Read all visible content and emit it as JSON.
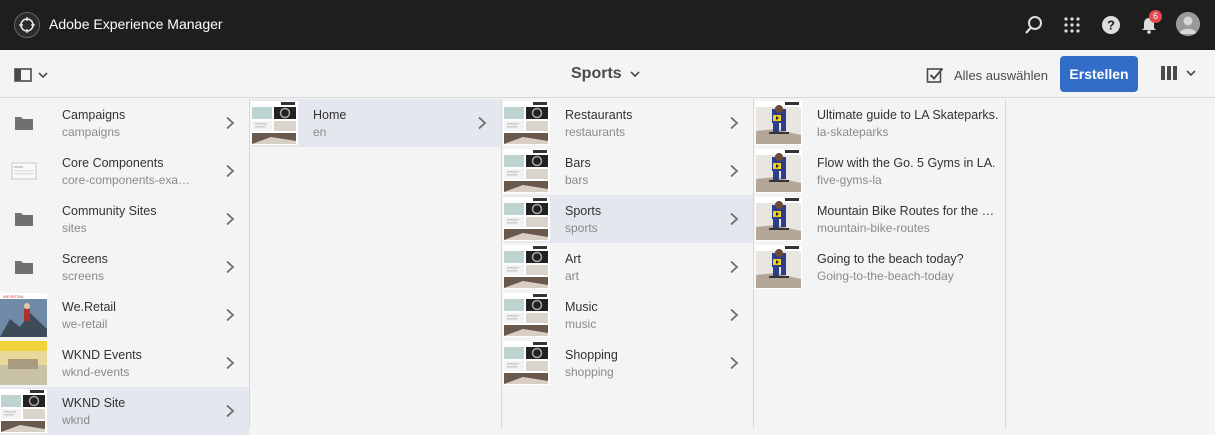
{
  "topbar": {
    "app_title": "Adobe Experience Manager",
    "notification_count": "6",
    "icons": [
      "search-icon",
      "apps-grid-icon",
      "help-icon",
      "bell-icon",
      "avatar"
    ]
  },
  "actionbar": {
    "title": "Sports",
    "select_all_label": "Alles auswählen",
    "create_label": "Erstellen"
  },
  "colors": {
    "topbar_bg": "#1e1e1e",
    "accent": "#326ec8",
    "active_row": "#e4e7ee",
    "badge": "#e34850"
  },
  "columns": [
    {
      "items": [
        {
          "title": "Campaigns",
          "name": "campaigns",
          "thumb": "folder",
          "active": false
        },
        {
          "title": "Core Components",
          "name": "core-components-exa…",
          "thumb": "template",
          "active": false
        },
        {
          "title": "Community Sites",
          "name": "sites",
          "thumb": "folder",
          "active": false
        },
        {
          "title": "Screens",
          "name": "screens",
          "thumb": "folder",
          "active": false
        },
        {
          "title": "We.Retail",
          "name": "we-retail",
          "thumb": "photo-hiker",
          "active": false
        },
        {
          "title": "WKND Events",
          "name": "wknd-events",
          "thumb": "photo-yellow",
          "active": false
        },
        {
          "title": "WKND Site",
          "name": "wknd",
          "thumb": "page",
          "active": true
        }
      ]
    },
    {
      "items": [
        {
          "title": "Home",
          "name": "en",
          "thumb": "page",
          "active": true
        }
      ]
    },
    {
      "items": [
        {
          "title": "Restaurants",
          "name": "restaurants",
          "thumb": "page",
          "active": false
        },
        {
          "title": "Bars",
          "name": "bars",
          "thumb": "page",
          "active": false
        },
        {
          "title": "Sports",
          "name": "sports",
          "thumb": "page",
          "active": true
        },
        {
          "title": "Art",
          "name": "art",
          "thumb": "page",
          "active": false
        },
        {
          "title": "Music",
          "name": "music",
          "thumb": "page",
          "active": false
        },
        {
          "title": "Shopping",
          "name": "shopping",
          "thumb": "page",
          "active": false
        }
      ]
    },
    {
      "items": [
        {
          "title": "Ultimate guide to LA Skateparks.",
          "name": "la-skateparks",
          "thumb": "skater",
          "active": false
        },
        {
          "title": "Flow with the Go. 5 Gyms in LA.",
          "name": "five-gyms-la",
          "thumb": "skater",
          "active": false
        },
        {
          "title": "Mountain Bike Routes for the …",
          "name": "mountain-bike-routes",
          "thumb": "skater",
          "active": false
        },
        {
          "title": "Going to the beach today?",
          "name": "Going-to-the-beach-today",
          "thumb": "skater",
          "active": false
        }
      ]
    }
  ]
}
